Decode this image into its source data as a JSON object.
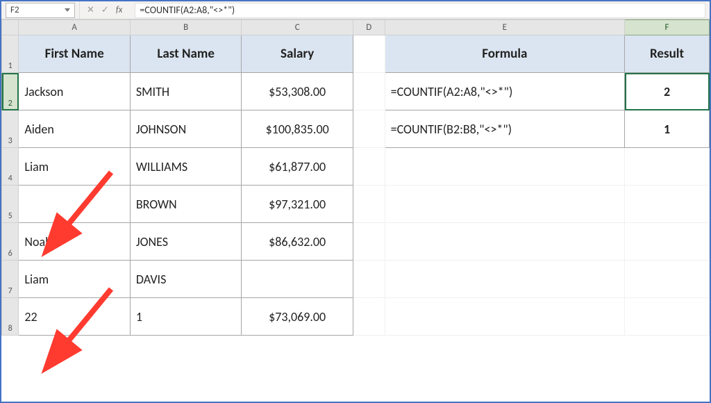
{
  "formula_bar": {
    "namebox": "F2",
    "cancel": "✕",
    "confirm": "✓",
    "fx_label": "fx",
    "formula": "=COUNTIF(A2:A8,\"<>*\")"
  },
  "columns": {
    "corner": "",
    "A": "A",
    "B": "B",
    "C": "C",
    "D": "D",
    "E": "E",
    "F": "F"
  },
  "rows": {
    "r1": "1",
    "r2": "2",
    "r3": "3",
    "r4": "4",
    "r5": "5",
    "r6": "6",
    "r7": "7",
    "r8": "8"
  },
  "headers": {
    "first_name": "First Name",
    "last_name": "Last Name",
    "salary": "Salary",
    "formula": "Formula",
    "result": "Result"
  },
  "t1": [
    {
      "first": "Jackson",
      "last": "SMITH",
      "salary": "$53,308.00"
    },
    {
      "first": "Aiden",
      "last": "JOHNSON",
      "salary": "$100,835.00"
    },
    {
      "first": "Liam",
      "last": "WILLIAMS",
      "salary": "$61,877.00"
    },
    {
      "first": "",
      "last": "BROWN",
      "salary": "$97,321.00"
    },
    {
      "first": "Noah",
      "last": "JONES",
      "salary": "$86,632.00"
    },
    {
      "first": "Liam",
      "last": "DAVIS",
      "salary": ""
    },
    {
      "first": "22",
      "last": "1",
      "salary": "$73,069.00"
    }
  ],
  "t2": [
    {
      "formula": "=COUNTIF(A2:A8,\"<>*\")",
      "result": "2"
    },
    {
      "formula": "=COUNTIF(B2:B8,\"<>*\")",
      "result": "1"
    }
  ],
  "arrow_color": "#ff3b30"
}
